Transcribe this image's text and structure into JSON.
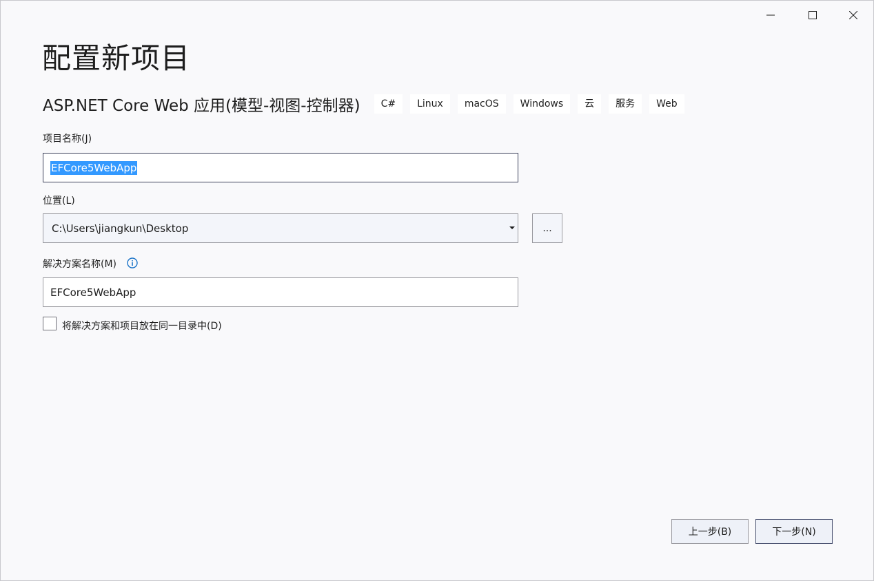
{
  "window": {
    "controls": {
      "minimize": "minimize-icon",
      "maximize": "maximize-icon",
      "close": "close-icon"
    }
  },
  "page_title": "配置新项目",
  "template": {
    "name": "ASP.NET Core Web 应用(模型-视图-控制器)",
    "tags": [
      "C#",
      "Linux",
      "macOS",
      "Windows",
      "云",
      "服务",
      "Web"
    ]
  },
  "project_name": {
    "label": "项目名称(J)",
    "value": "EFCore5WebApp"
  },
  "location": {
    "label": "位置(L)",
    "value": "C:\\Users\\jiangkun\\Desktop",
    "browse_label": "..."
  },
  "solution_name": {
    "label": "解决方案名称(M)",
    "value": "EFCore5WebApp",
    "info_icon": "info-icon"
  },
  "same_directory": {
    "label": "将解决方案和项目放在同一目录中(D)",
    "checked": false
  },
  "buttons": {
    "back": "上一步(B)",
    "next": "下一步(N)"
  },
  "colors": {
    "background": "#f9f9fb",
    "selection": "#3399ff",
    "info_icon": "#1a73c8"
  }
}
